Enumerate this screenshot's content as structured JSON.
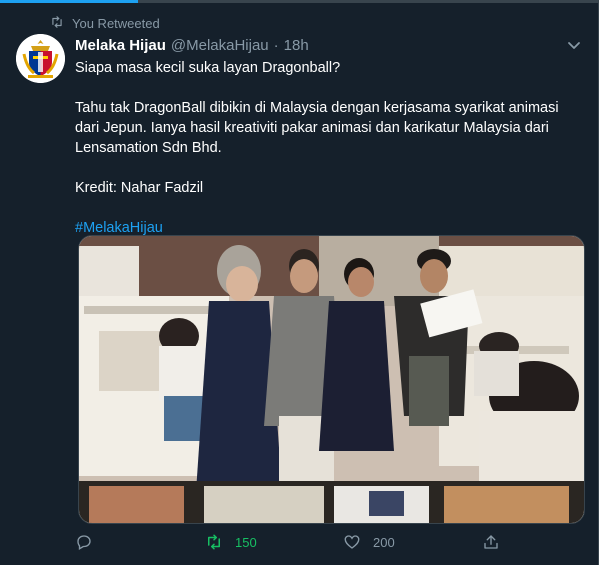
{
  "retweet_context": {
    "label": "You Retweeted",
    "icon": "retweet-icon"
  },
  "tweet": {
    "display_name": "Melaka Hijau",
    "handle": "@MelakaHijau",
    "separator": "·",
    "time": "18h",
    "lines": [
      "Siapa masa kecil suka layan Dragonball?",
      "Tahu tak DragonBall dibikin di Malaysia dengan kerjasama syarikat animasi dari Jepun. Ianya hasil kreativiti pakar animasi dan karikatur Malaysia dari Lensamation Sdn Bhd.",
      "Kredit: Nahar Fadzil"
    ],
    "hashtag": "#MelakaHijau"
  },
  "actions": {
    "reply_count": "",
    "retweet_count": "150",
    "like_count": "200"
  },
  "colors": {
    "background": "#15202b",
    "accent": "#1da1f2",
    "retweet_active": "#17bf63",
    "muted": "#8899a6"
  },
  "icons": [
    "retweet-icon",
    "chevron-down-icon",
    "reply-icon",
    "like-icon",
    "share-icon",
    "avatar-crest-icon"
  ]
}
